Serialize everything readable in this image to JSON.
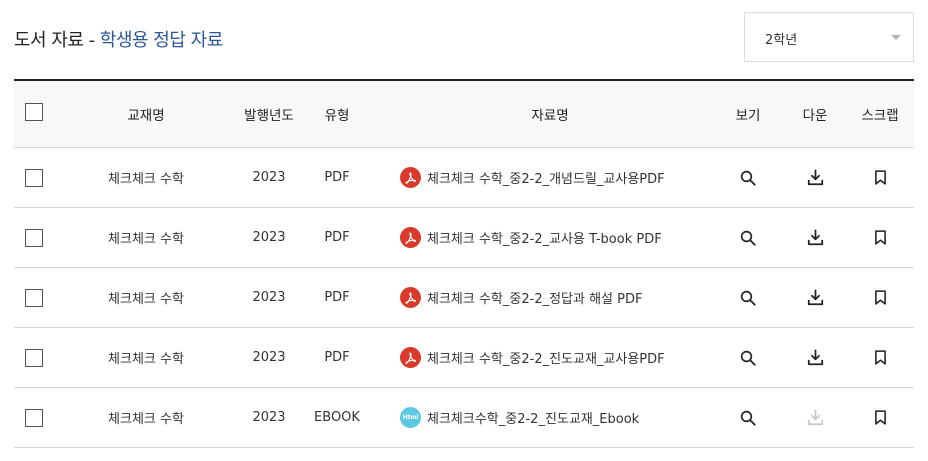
{
  "header": {
    "title_prefix": "도서 자료 - ",
    "title_accent": "학생용 정답 자료",
    "grade_select": {
      "selected": "2학년"
    }
  },
  "colors": {
    "accent": "#2b5797",
    "pdf_icon": "#d93a2b",
    "ebook_icon": "#5cc9e0",
    "disabled_icon": "#c8c8c8"
  },
  "table": {
    "headers": {
      "book": "교재명",
      "year": "발행년도",
      "type": "유형",
      "name": "자료명",
      "view": "보기",
      "download": "다운",
      "scrap": "스크랩"
    },
    "rows": [
      {
        "book": "체크체크 수학",
        "year": "2023",
        "type": "PDF",
        "file_icon": "pdf-icon",
        "name": "체크체크 수학_중2-2_개념드릴_교사용PDF",
        "download_enabled": true
      },
      {
        "book": "체크체크 수학",
        "year": "2023",
        "type": "PDF",
        "file_icon": "pdf-icon",
        "name": "체크체크 수학_중2-2_교사용 T-book PDF",
        "download_enabled": true
      },
      {
        "book": "체크체크 수학",
        "year": "2023",
        "type": "PDF",
        "file_icon": "pdf-icon",
        "name": "체크체크 수학_중2-2_정답과 해설 PDF",
        "download_enabled": true
      },
      {
        "book": "체크체크 수학",
        "year": "2023",
        "type": "PDF",
        "file_icon": "pdf-icon",
        "name": "체크체크 수학_중2-2_진도교재_교사용PDF",
        "download_enabled": true
      },
      {
        "book": "체크체크 수학",
        "year": "2023",
        "type": "EBOOK",
        "file_icon": "html-icon",
        "file_icon_text": "Html",
        "name": "체크체크수학_중2-2_진도교재_Ebook",
        "download_enabled": false
      }
    ]
  }
}
